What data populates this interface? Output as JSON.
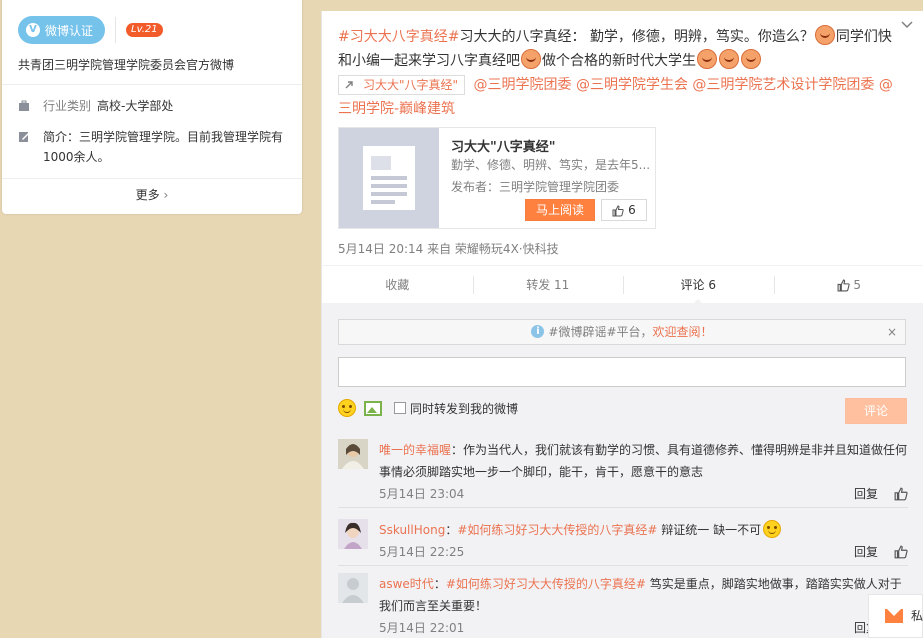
{
  "profile": {
    "verify_label": "微博认证",
    "level": "Lv.21",
    "name": "共青团三明学院管理学院委员会官方微博",
    "industry_label": "行业类别",
    "industry_value": "高校-大学部处",
    "intro": "简介：三明学院管理学院。目前我管理学院有1000余人。",
    "more_label": "更多",
    "more_arrow": "›"
  },
  "post": {
    "hashtag": "#习大大八字真经#",
    "text1": "习大大的八字真经： 勤学，修德，明辨，笃实。你造么？",
    "text2": "同学们快和小编一起来学习八字真经吧",
    "text3": "做个合格的新时代大学生",
    "link_chip": "习大大\"八字真经\"",
    "mentions": [
      "@三明学院团委",
      "@三明学院学生会",
      "@三明学院艺术设计学院团委",
      "@三明学院-巅峰建筑"
    ],
    "article": {
      "title": "习大大\"八字真经\"",
      "desc": "勤学、修德、明辨、笃实，是去年5...",
      "publisher": "发布者：三明学院管理学院团委",
      "read_label": "马上阅读",
      "likes": "6"
    },
    "meta": "5月14日 20:14 来自 荣耀畅玩4X·快科技"
  },
  "actions": [
    {
      "label": "收藏"
    },
    {
      "label": "转发 11"
    },
    {
      "label": "评论 6"
    },
    {
      "label": "5"
    }
  ],
  "comment_box": {
    "notice_tag": "#微博辟谣#平台，",
    "notice_highlight": "欢迎查阅！",
    "close": "×",
    "repost_label": "同时转发到我的微博",
    "submit_label": "评论"
  },
  "comments": [
    {
      "user": "唯一的幸福喔",
      "text": "：作为当代人，我们就该有勤学的习惯、具有道德修养、懂得明辨是非并且知道做任何事情必须脚踏实地一步一个脚印，能干，肯干，愿意干的意志",
      "time": "5月14日 23:04",
      "reply": "回复"
    },
    {
      "user": "SskullHong",
      "hashtag": "#如何练习好习大大传授的八字真经#",
      "text": " 辩证统一 缺一不可",
      "time": "5月14日 22:25",
      "reply": "回复"
    },
    {
      "user": "aswe时代",
      "hashtag": "#如何练习好习大大传授的八字真经#",
      "text": " 笃实是重点，脚踏实地做事，踏踏实实做人对于我们而言至关重要！",
      "time": "5月14日 22:01",
      "reply": "回复"
    }
  ],
  "float_msg": {
    "label": "私"
  },
  "colors": {
    "accent": "#eb7350",
    "background": "#e8d7b3",
    "verify": "#75c2eb"
  }
}
